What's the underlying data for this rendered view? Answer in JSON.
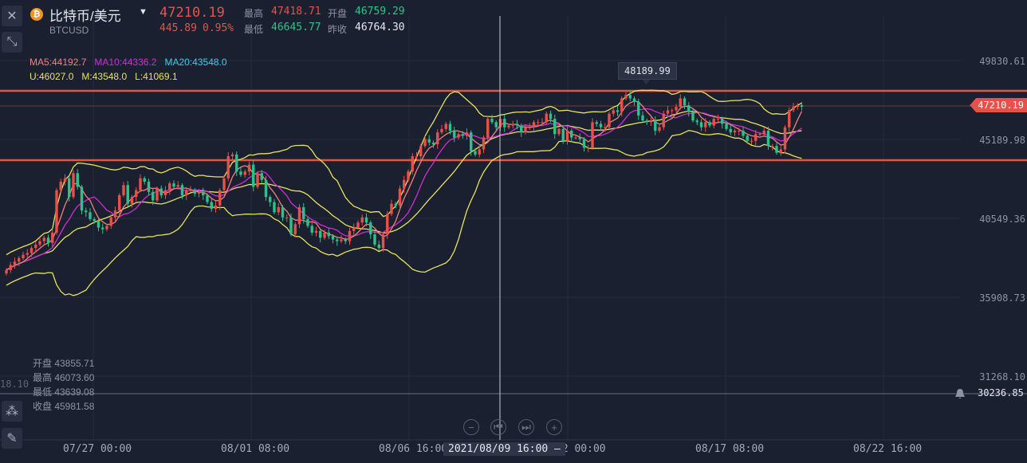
{
  "symbol": {
    "name": "比特币/美元",
    "code": "BTCUSD",
    "price": "47210.19",
    "change": "445.89",
    "change_pct": "0.95%"
  },
  "stats": {
    "high_label": "最高",
    "high": "47418.71",
    "open_label": "开盘",
    "open": "46759.29",
    "low_label": "最低",
    "low": "46645.77",
    "prev_close_label": "昨收",
    "prev_close": "46764.30"
  },
  "indicators": {
    "ma5": "MA5:44192.7",
    "ma10": "MA10:44336.2",
    "ma20": "MA20:43548.0",
    "boll_u": "U:46027.0",
    "boll_m": "M:43548.0",
    "boll_l": "L:41069.1"
  },
  "cursor_ohlc": {
    "open": "开盘 43855.71",
    "high": "最高 46073.60",
    "low": "最低 43639.08",
    "close": "收盘 45981.58",
    "left_edge_value": "18.10"
  },
  "price_axis": [
    "49830.61",
    "45189.98",
    "40549.36",
    "35908.73",
    "31268.10"
  ],
  "time_axis": [
    "07/27 00:00",
    "08/01 08:00",
    "08/06 16:00",
    "12 00:00",
    "08/17 08:00",
    "08/22 16:00"
  ],
  "current_price_tag": "47210.19",
  "alert_price": "30236.85",
  "high_marker": "48189.99",
  "crosshair_date": "2021/08/09 16:00",
  "colors": {
    "up": "#e8514a",
    "down": "#2ec28b",
    "ma5": "#f08080",
    "ma10": "#d12bd6",
    "boll": "#e6e35a",
    "hline": "#e2553f",
    "bg": "#1b2030"
  },
  "chart_data": {
    "type": "candlestick",
    "ylim": [
      31268.1,
      49830.61
    ],
    "close": [
      37600,
      37900,
      38100,
      38300,
      38500,
      38600,
      38900,
      39100,
      39300,
      39500,
      39200,
      39800,
      42300,
      42800,
      43000,
      41900,
      43300,
      42500,
      41100,
      41000,
      40600,
      40500,
      40100,
      40000,
      40200,
      40700,
      41100,
      42000,
      42600,
      41500,
      41900,
      42300,
      43000,
      42800,
      42200,
      41700,
      42400,
      42000,
      42300,
      42700,
      42500,
      42600,
      42000,
      42300,
      42300,
      42100,
      42200,
      42000,
      41600,
      41200,
      41400,
      42300,
      43000,
      44300,
      44400,
      43400,
      43200,
      43400,
      43800,
      42500,
      43300,
      42900,
      41900,
      41600,
      41000,
      41300,
      40700,
      40700,
      39700,
      40300,
      41300,
      40600,
      40200,
      39800,
      39900,
      39500,
      39800,
      39600,
      39400,
      39300,
      39400,
      39300,
      39900,
      40100,
      40400,
      40700,
      40400,
      39700,
      39100,
      38900,
      39700,
      40900,
      41500,
      41400,
      42400,
      42900,
      43400,
      44300,
      44300,
      44900,
      45300,
      45100,
      45000,
      45700,
      45900,
      46200,
      45800,
      45400,
      45600,
      45500,
      45700,
      44600,
      44400,
      44700,
      45400,
      46500,
      46300,
      46000,
      46500,
      46000,
      46100,
      46200,
      46100,
      45700,
      46000,
      46000,
      46300,
      46300,
      46300,
      46800,
      46500,
      45600,
      45900,
      45200,
      45800,
      45400,
      45400,
      45300,
      44800,
      44800,
      46300,
      46200,
      46000,
      46000,
      46800,
      47000,
      46900,
      47700,
      47900,
      47700,
      47500,
      46700,
      46400,
      46300,
      46400,
      45800,
      46000,
      46800,
      47000,
      47000,
      47200,
      47700,
      47300,
      46900,
      46400,
      46300,
      46000,
      46300,
      46100,
      46500,
      46500,
      46200,
      45900,
      45700,
      45800,
      45800,
      45500,
      45200,
      45200,
      45600,
      45600,
      45800,
      44900,
      44900,
      44500,
      44700,
      46000,
      47000,
      47200,
      47300,
      47210
    ]
  }
}
